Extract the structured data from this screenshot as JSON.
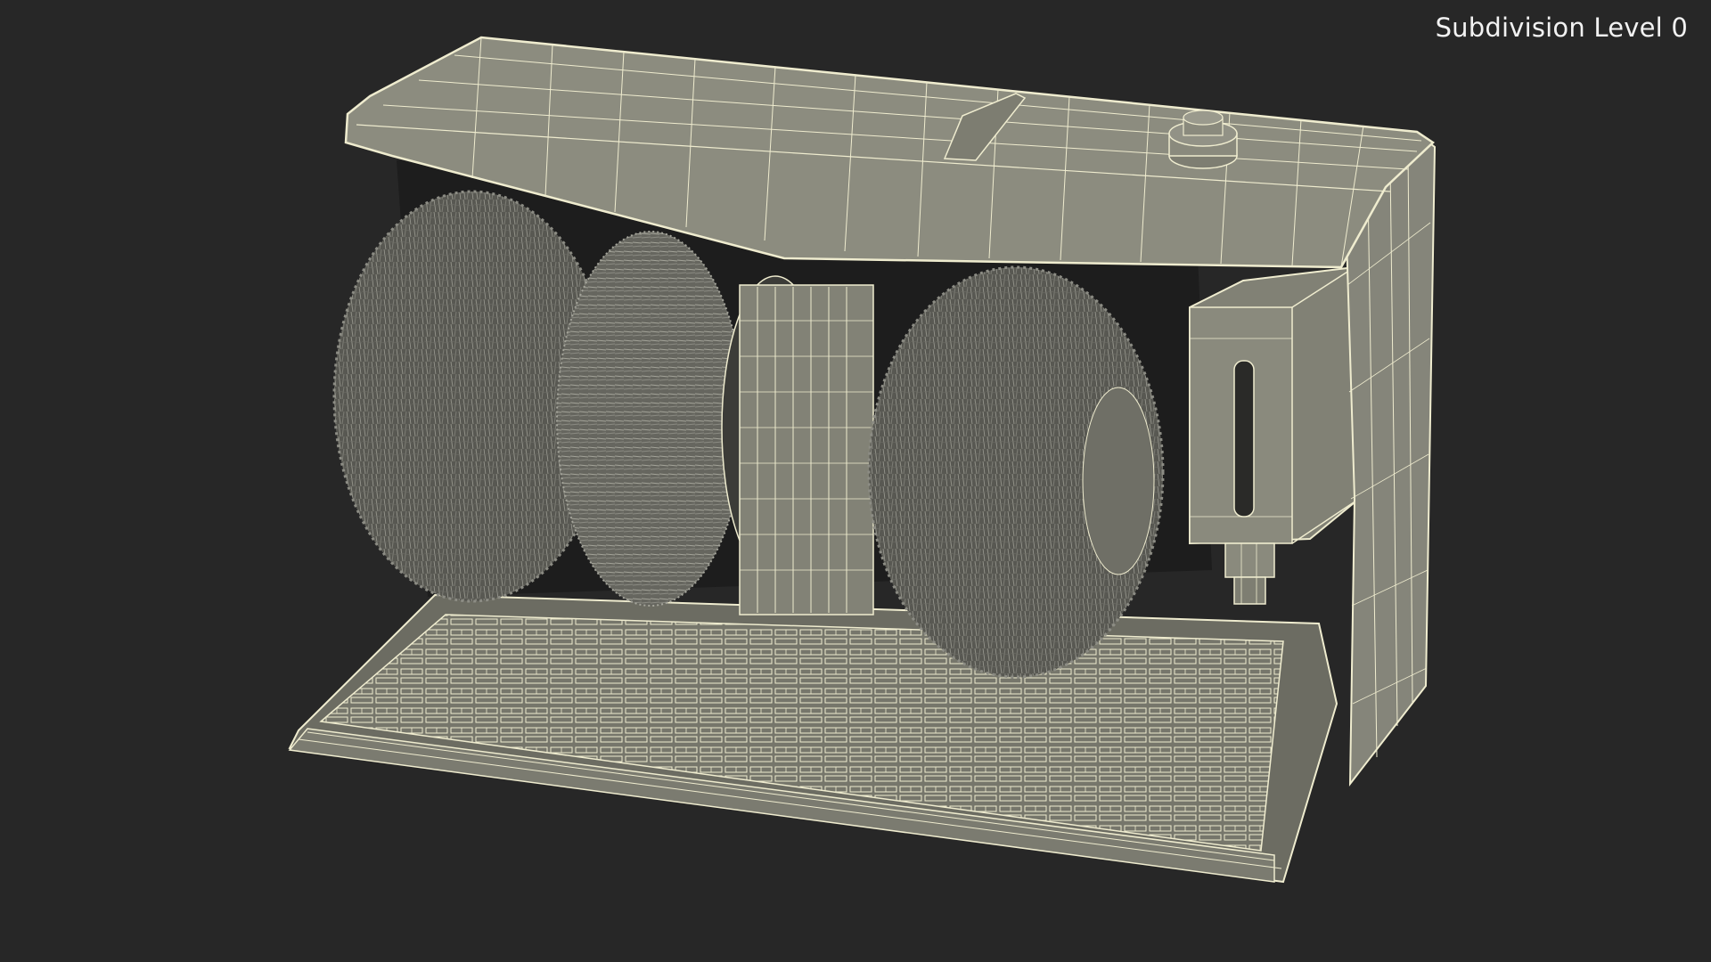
{
  "viewport": {
    "label": "Subdivision Level 0",
    "colors": {
      "background": "#272727",
      "model_fill": "#8a8a7c",
      "model_shadow": "#6c6c60",
      "wire": "#f4f2d6",
      "brush": "#5c5c55",
      "brush_light": "#9a9a90",
      "interior": "#1c1c1c"
    }
  }
}
